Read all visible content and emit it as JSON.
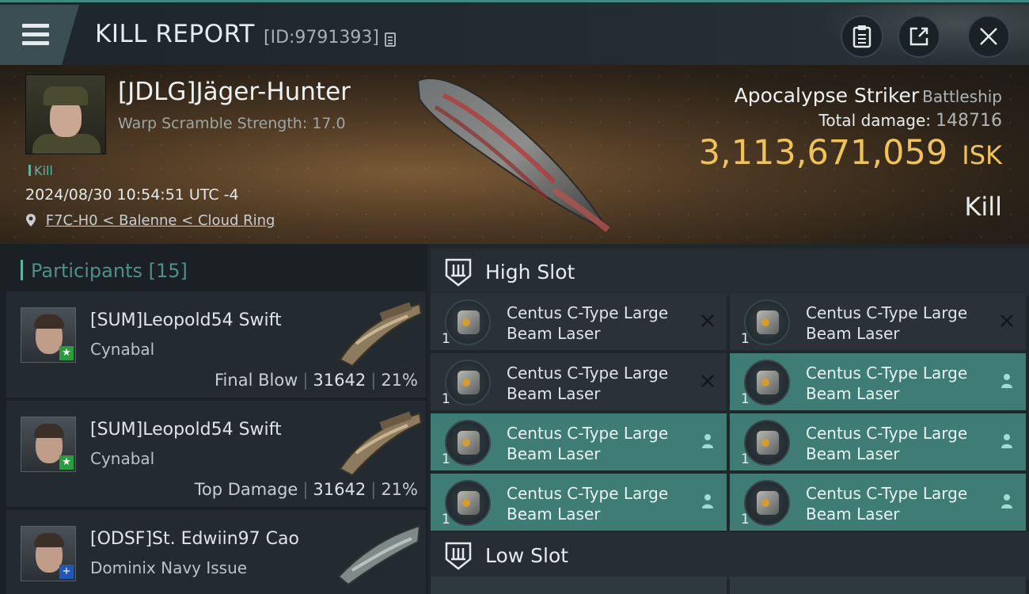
{
  "header": {
    "title": "KILL REPORT",
    "report_id": "[ID:9791393]"
  },
  "victim": {
    "name": "[JDLG]Jäger-Hunter",
    "warp_scramble": "Warp Scramble Strength: 17.0",
    "tag": "Kill",
    "datetime": "2024/08/30 10:54:51 UTC -4",
    "location": "F7C-H0 < Balenne < Cloud Ring",
    "ship_name": "Apocalypse Striker",
    "ship_class": "Battleship",
    "total_damage_label": "Total damage:",
    "total_damage_value": "148716",
    "isk_value": "3,113,671,059",
    "isk_unit": "ISK",
    "result": "Kill"
  },
  "participants": {
    "title": "Participants",
    "count": "[15]",
    "rows": [
      {
        "name": "[SUM]Leopold54 Swift",
        "ship": "Cynabal",
        "role": "Final Blow",
        "damage": "31642",
        "percent": "21%",
        "badge": "★",
        "badge_color": "#2a9c3f"
      },
      {
        "name": "[SUM]Leopold54 Swift",
        "ship": "Cynabal",
        "role": "Top Damage",
        "damage": "31642",
        "percent": "21%",
        "badge": "★",
        "badge_color": "#2a9c3f"
      },
      {
        "name": "[ODSF]St. Edwiin97 Cao",
        "ship": "Dominix Navy Issue",
        "badge": "+",
        "badge_color": "#2456b8"
      }
    ]
  },
  "high_slot": {
    "title": "High Slot",
    "modules": [
      {
        "name": "Centus C-Type Large Beam Laser",
        "qty": "1",
        "status": "destroyed"
      },
      {
        "name": "Centus C-Type Large Beam Laser",
        "qty": "1",
        "status": "destroyed"
      },
      {
        "name": "Centus C-Type Large Beam Laser",
        "qty": "1",
        "status": "destroyed"
      },
      {
        "name": "Centus C-Type Large Beam Laser",
        "qty": "1",
        "status": "dropped"
      },
      {
        "name": "Centus C-Type Large Beam Laser",
        "qty": "1",
        "status": "dropped"
      },
      {
        "name": "Centus C-Type Large Beam Laser",
        "qty": "1",
        "status": "dropped"
      },
      {
        "name": "Centus C-Type Large Beam Laser",
        "qty": "1",
        "status": "dropped"
      },
      {
        "name": "Centus C-Type Large Beam Laser",
        "qty": "1",
        "status": "dropped"
      }
    ]
  },
  "low_slot": {
    "title": "Low Slot"
  },
  "colors": {
    "accent": "#5bb3a6",
    "isk": "#f0c25a",
    "dropped": "#3f7c75"
  }
}
